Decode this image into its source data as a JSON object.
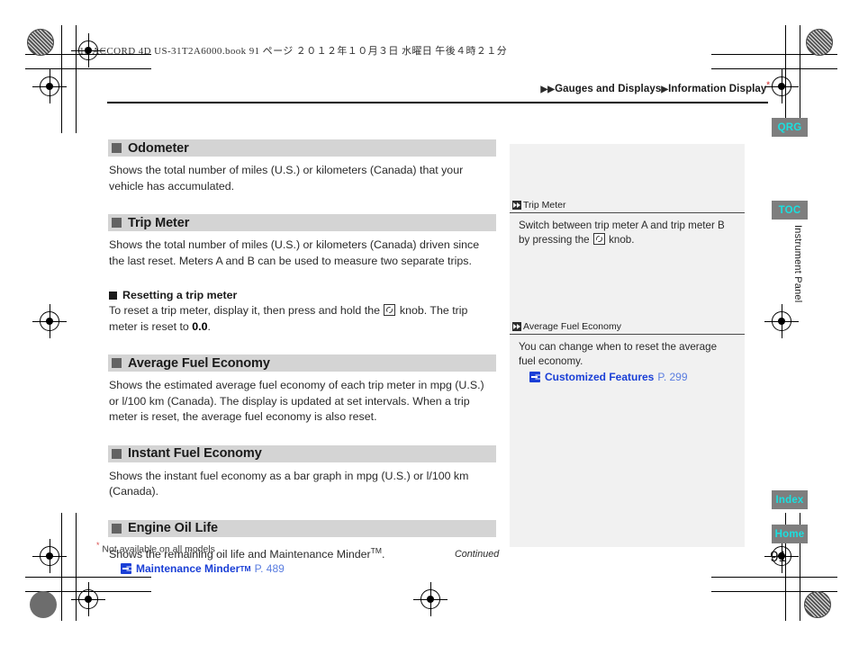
{
  "file_header": "13 ACCORD 4D US-31T2A6000.book   91 ページ   ２０１２年１０月３日   水曜日   午後４時２１分",
  "breadcrumb": {
    "arrow_double": "▶▶",
    "level1": "Gauges and Displays",
    "arrow_single": "▶",
    "level2": "Information Display",
    "star": "*"
  },
  "sections": [
    {
      "heading": "Odometer",
      "body": "Shows the total number of miles (U.S.) or kilometers (Canada) that your vehicle has accumulated."
    },
    {
      "heading": "Trip Meter",
      "body": "Shows the total number of miles (U.S.) or kilometers (Canada) driven since the last reset. Meters A and B can be used to measure two separate trips."
    },
    {
      "heading": "Average Fuel Economy",
      "body": "Shows the estimated average fuel economy of each trip meter in mpg (U.S.) or l/100 km (Canada). The display is updated at set intervals. When a trip meter is reset, the average fuel economy is also reset."
    },
    {
      "heading": "Instant Fuel Economy",
      "body": "Shows the instant fuel economy as a bar graph in mpg (U.S.) or l/100 km (Canada)."
    },
    {
      "heading": "Engine Oil Life",
      "body": "Shows the remaining oil life and Maintenance Minder"
    }
  ],
  "subsection": {
    "heading": "Resetting a trip meter",
    "text_before_icon": "To reset a trip meter, display it, then press and hold the ",
    "icon_name": "knob-icon",
    "text_after_icon": " knob. The trip meter is reset to ",
    "reset_value": "0.0",
    "text_end": "."
  },
  "engine_oil_life": {
    "trademark": "TM",
    "period": ".",
    "xref_title": "Maintenance Minder",
    "xref_title_sup": "TM",
    "xref_page": "P. 489"
  },
  "side_notes": [
    {
      "label": "Trip Meter",
      "body_before_icon": "Switch between trip meter A and trip meter B by pressing the ",
      "icon_name": "knob-icon",
      "body_after_icon": " knob."
    },
    {
      "label": "Average Fuel Economy",
      "body": "You can change when to reset the average fuel economy.",
      "xref_title": "Customized Features",
      "xref_page": "P. 299"
    }
  ],
  "tabs": [
    {
      "id": "qrg",
      "label": "QRG"
    },
    {
      "id": "toc",
      "label": "TOC"
    },
    {
      "id": "index",
      "label": "Index"
    },
    {
      "id": "home",
      "label": "Home"
    }
  ],
  "chapter_tab": "Instrument Panel",
  "footnote": {
    "star": "*",
    "text": " Not available on all models"
  },
  "continued": "Continued",
  "page_number": "91",
  "colors": {
    "section_heading_bg": "#d4d4d4",
    "section_bullet": "#636363",
    "side_panel_bg": "#f1f1f1",
    "tab_bg": "#7e7e7e",
    "tab_text": "#1ae0e0",
    "xref_blue": "#1a3fd6",
    "xref_page_blue": "#5a7de0",
    "asterisk_red": "#d94f4f"
  }
}
